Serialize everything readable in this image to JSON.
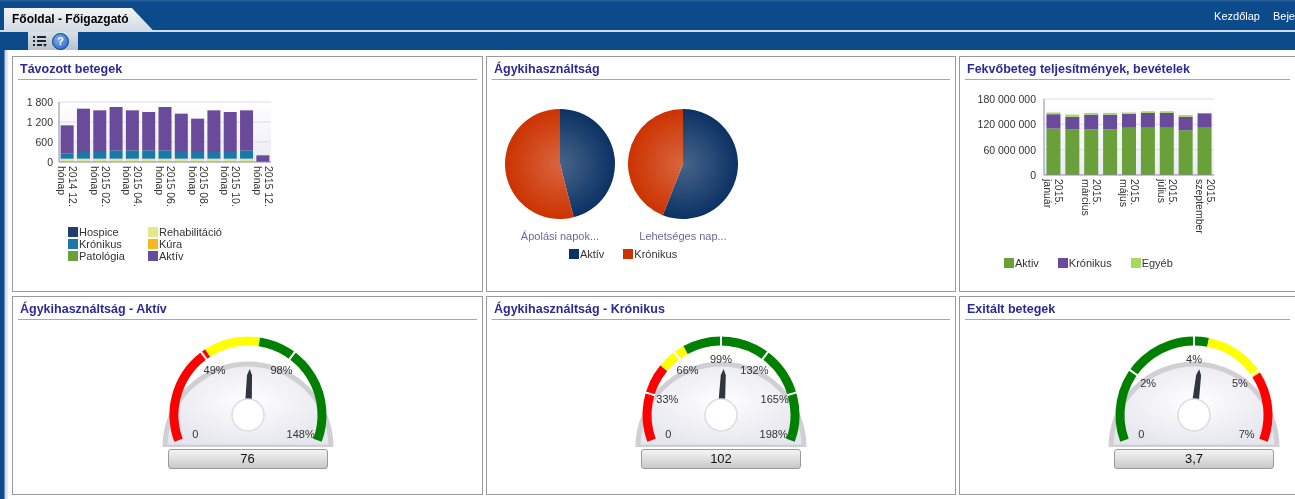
{
  "header": {
    "tab": {
      "label": "Főoldal - Főigazgató",
      "selected": true
    },
    "links": [
      "Kezdőlap",
      "Beje"
    ]
  },
  "toolbar": {
    "help_icon": "?"
  },
  "panels": [
    {
      "kind": "bar_chart",
      "title": "Távozott betegek",
      "chart_data": {
        "type": "bar",
        "stacked": true,
        "categories": [
          "2014 12. hónap",
          null,
          "2015 02. hónap",
          null,
          "2015 04. hónap",
          null,
          "2015 06. hónap",
          null,
          "2015 08. hónap",
          null,
          "2015 10. hónap",
          null,
          "2015 12. hónap"
        ],
        "ylim": [
          0,
          1800
        ],
        "yticks": [
          {
            "value": 0,
            "label": "0"
          },
          {
            "value": 600,
            "label": "600"
          },
          {
            "value": 1200,
            "label": "1 200"
          },
          {
            "value": 1800,
            "label": "1 800"
          }
        ],
        "series": [
          {
            "name": "Hospice",
            "color": "#1c3f6e",
            "values": [
              0,
              0,
              0,
              0,
              0,
              0,
              0,
              0,
              0,
              0,
              0,
              0,
              0
            ]
          },
          {
            "name": "Rehabilitáció",
            "color": "#e6e68a",
            "values": [
              100,
              100,
              100,
              100,
              100,
              100,
              100,
              100,
              100,
              100,
              100,
              100,
              0
            ]
          },
          {
            "name": "Krónikus",
            "color": "#1a78a6",
            "values": [
              150,
              200,
              200,
              250,
              250,
              250,
              250,
              200,
              200,
              200,
              200,
              250,
              0
            ]
          },
          {
            "name": "Kúra",
            "color": "#f5b820",
            "values": [
              0,
              0,
              0,
              0,
              0,
              0,
              0,
              0,
              0,
              0,
              0,
              0,
              0
            ]
          },
          {
            "name": "Patológia",
            "color": "#6aa03a",
            "values": [
              0,
              0,
              0,
              0,
              0,
              0,
              0,
              0,
              0,
              0,
              0,
              0,
              0
            ]
          },
          {
            "name": "Aktív",
            "color": "#6a4a9a",
            "values": [
              850,
              1300,
              1250,
              1300,
              1200,
              1150,
              1300,
              1150,
              1000,
              1250,
              1200,
              1200,
              200
            ]
          }
        ]
      }
    },
    {
      "kind": "pies",
      "title": "Ágykihasználtság",
      "pies": [
        {
          "caption": "Ápolási napok..."
        },
        {
          "caption": "Lehetséges nap..."
        }
      ],
      "legend": [
        {
          "label": "Aktív",
          "color": "#0b3264"
        },
        {
          "label": "Krónikus",
          "color": "#cc3300"
        }
      ]
    },
    {
      "kind": "bar_chart",
      "title": "Fekvőbeteg teljesítmények, bevételek",
      "chart_data": {
        "type": "bar",
        "stacked": true,
        "categories": [
          "2015. január",
          null,
          "2015. március",
          null,
          "2015. május",
          null,
          "2015. július",
          null,
          "2015. szeptember"
        ],
        "ylim": [
          0,
          180000000
        ],
        "yticks": [
          {
            "value": 0,
            "label": "0"
          },
          {
            "value": 60000000,
            "label": "60 000 000"
          },
          {
            "value": 120000000,
            "label": "120 000 000"
          },
          {
            "value": 180000000,
            "label": "180 000 000"
          }
        ],
        "series": [
          {
            "name": "Aktiv",
            "color": "#6aa03a",
            "values": [
              110000000,
              108000000,
              108000000,
              108000000,
              112000000,
              112000000,
              112000000,
              106000000,
              112000000
            ]
          },
          {
            "name": "Krónikus",
            "color": "#6a4a9a",
            "values": [
              34000000,
              30000000,
              35000000,
              35000000,
              33000000,
              35000000,
              35000000,
              32000000,
              34000000
            ]
          },
          {
            "name": "Egyéb",
            "color": "#a8d860",
            "values": [
              4000000,
              5000000,
              4000000,
              4000000,
              3000000,
              4000000,
              4000000,
              4000000,
              0
            ]
          }
        ]
      }
    },
    {
      "kind": "gauge",
      "title": "Ágykihasználtság - Aktív",
      "ticks": [
        "0",
        "49%",
        "98%",
        "148%"
      ],
      "bands": [
        {
          "color": "#ff0000"
        },
        {
          "color": "#ffff00"
        },
        {
          "color": "#008000"
        }
      ],
      "level": 0.51,
      "reading": "76"
    },
    {
      "kind": "gauge",
      "title": "Ágykihasználtság - Krónikus",
      "ticks": [
        "0",
        "33%",
        "66%",
        "99%",
        "132%",
        "165%",
        "198%"
      ],
      "bands": [
        {
          "color": "#ff0000"
        },
        {
          "color": "#ffff00"
        },
        {
          "color": "#008000"
        }
      ],
      "level": 0.515,
      "reading": "102"
    },
    {
      "kind": "gauge",
      "title": "Exitált betegek",
      "ticks": [
        "0",
        "2%",
        "4%",
        "5%",
        "7%"
      ],
      "bands": [
        {
          "color": "#008000"
        },
        {
          "color": "#ffff00"
        },
        {
          "color": "#ff0000"
        }
      ],
      "level": 0.53,
      "reading": "3,7"
    }
  ]
}
